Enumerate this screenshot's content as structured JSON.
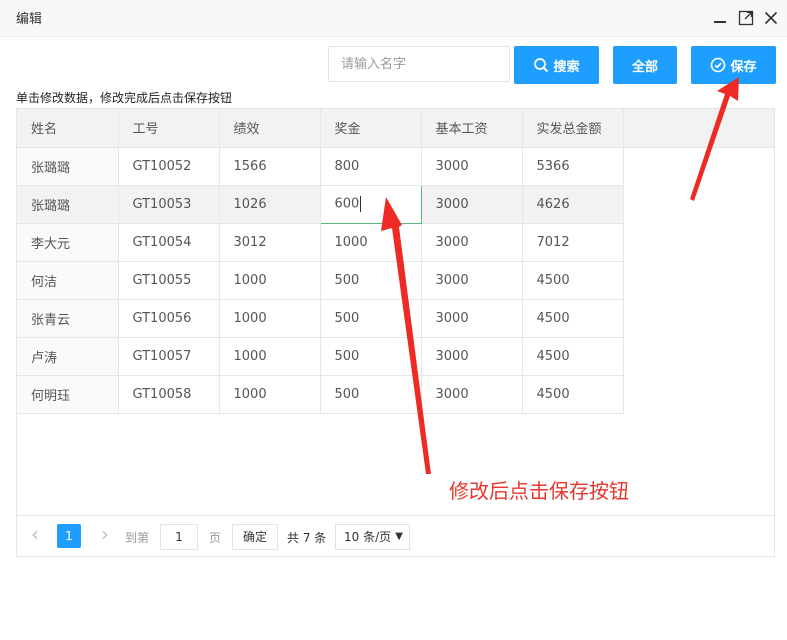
{
  "window": {
    "title": "编辑"
  },
  "toolbar": {
    "search_placeholder": "请输入名字",
    "search_label": "搜索",
    "all_label": "全部",
    "save_label": "保存"
  },
  "hint": "单击修改数据，修改完成后点击保存按钮",
  "table": {
    "columns": [
      "姓名",
      "工号",
      "绩效",
      "奖金",
      "基本工资",
      "实发总金额"
    ],
    "rows": [
      [
        "张璐璐",
        "GT10052",
        "1566",
        "800",
        "3000",
        "5366"
      ],
      [
        "张璐璐",
        "GT10053",
        "1026",
        "600",
        "3000",
        "4626"
      ],
      [
        "李大元",
        "GT10054",
        "3012",
        "1000",
        "3000",
        "7012"
      ],
      [
        "何洁",
        "GT10055",
        "1000",
        "500",
        "3000",
        "4500"
      ],
      [
        "张青云",
        "GT10056",
        "1000",
        "500",
        "3000",
        "4500"
      ],
      [
        "卢涛",
        "GT10057",
        "1000",
        "500",
        "3000",
        "4500"
      ],
      [
        "何明珏",
        "GT10058",
        "1000",
        "500",
        "3000",
        "4500"
      ]
    ]
  },
  "pager": {
    "prev": "‹",
    "current_page": "1",
    "next": "›",
    "goto_prefix": "到第",
    "goto_value": "1",
    "page_suffix": "页",
    "confirm_label": "确定",
    "total_label": "共 7 条",
    "page_size_label": "10 条/页"
  },
  "annotation": "修改后点击保存按钮",
  "colors": {
    "primary": "#1e9fff",
    "annotation": "#e8362c",
    "edit_border": "#5fb878"
  }
}
